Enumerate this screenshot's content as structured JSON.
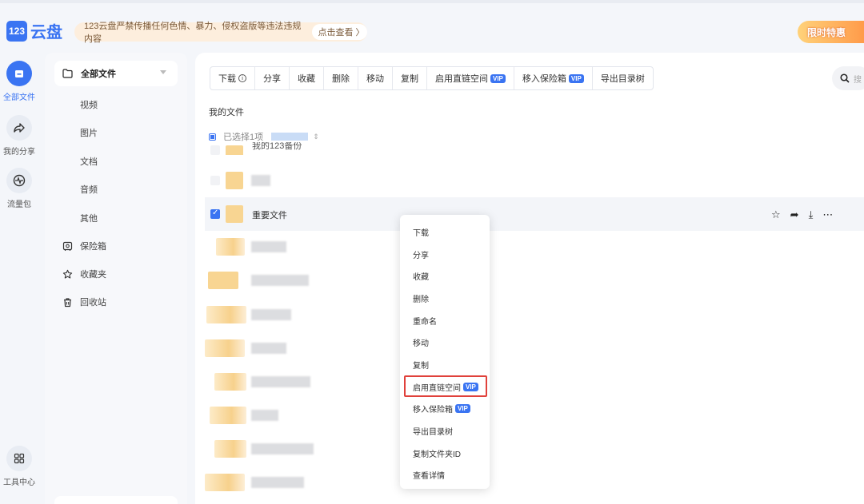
{
  "header": {
    "logo_mark": "123",
    "logo_text": "云盘",
    "notice": "123云盘严禁传播任何色情、暴力、侵权盗版等违法违规内容",
    "notice_link": "点击查看 〉",
    "promo": "限时特惠"
  },
  "rail": [
    {
      "label": "全部文件",
      "icon": "folder-icon",
      "active": true
    },
    {
      "label": "我的分享",
      "icon": "share-icon"
    },
    {
      "label": "流量包",
      "icon": "traffic-icon"
    },
    {
      "label": "工具中心",
      "icon": "grid-icon"
    }
  ],
  "nav": {
    "head": "全部文件",
    "subs": [
      "视频",
      "图片",
      "文档",
      "音频",
      "其他"
    ],
    "rows": [
      {
        "label": "保险箱",
        "icon": "safe-icon"
      },
      {
        "label": "收藏夹",
        "icon": "star-icon"
      },
      {
        "label": "回收站",
        "icon": "trash-icon"
      }
    ]
  },
  "toolbar": {
    "download": "下载",
    "share": "分享",
    "favorite": "收藏",
    "delete": "删除",
    "move": "移动",
    "copy": "复制",
    "direct_link": "启用直链空间",
    "move_safe": "移入保险箱",
    "export_tree": "导出目录树",
    "vip": "VIP",
    "search_placeholder": "搜"
  },
  "breadcrumb": "我的文件",
  "selection": {
    "text": "已选择1项",
    "sort": "⇕"
  },
  "files": {
    "partial": "我的123备份",
    "selected": "重要文件"
  },
  "context_menu": {
    "download": "下载",
    "share": "分享",
    "favorite": "收藏",
    "delete": "删除",
    "rename": "重命名",
    "move": "移动",
    "copy": "复制",
    "direct_link": "启用直链空间",
    "move_safe": "移入保险箱",
    "export_tree": "导出目录树",
    "copy_id": "复制文件夹ID",
    "details": "查看详情",
    "vip": "VIP"
  },
  "colors": {
    "accent": "#3a74f2",
    "highlight": "#e0413b",
    "folder": "#f8d592"
  }
}
